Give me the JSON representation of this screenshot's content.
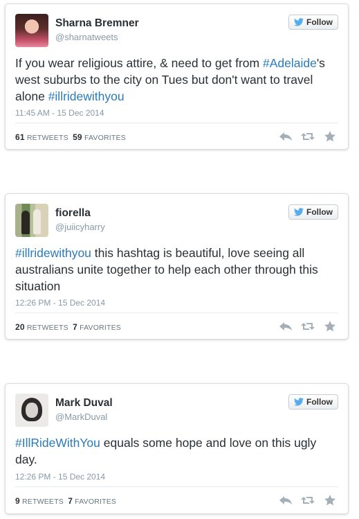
{
  "colors": {
    "hashtag": "#2b7bb9",
    "name": "#292f33",
    "muted": "#8899a6",
    "bird": "#55acee"
  },
  "follow_label": "Follow",
  "icons": [
    "twitter-bird-icon",
    "reply-icon",
    "retweet-icon",
    "favorite-star-icon"
  ],
  "tweets": [
    {
      "name": "Sharna Bremner",
      "handle": "@sharnatweets",
      "text_parts": [
        {
          "t": "If you wear religious attire, & need to get from ",
          "tag": false
        },
        {
          "t": "#Adelaide",
          "tag": true
        },
        {
          "t": "'s west suburbs to the city on Tues but don't want to travel alone ",
          "tag": false
        },
        {
          "t": "#illridewithyou",
          "tag": true
        }
      ],
      "time": "11:45 AM - 15 Dec 2014",
      "retweets": "61",
      "retweets_label": "RETWEETS",
      "favorites": "59",
      "favorites_label": "FAVORITES"
    },
    {
      "name": "fiorella",
      "handle": "@juiicyharry",
      "text_parts": [
        {
          "t": "#illridewithyou",
          "tag": true
        },
        {
          "t": " this hashtag is beautiful, love seeing all australians unite together to help each other through this situation",
          "tag": false
        }
      ],
      "time": "12:26 PM - 15 Dec 2014",
      "retweets": "20",
      "retweets_label": "RETWEETS",
      "favorites": "7",
      "favorites_label": "FAVORITES"
    },
    {
      "name": "Mark Duval",
      "handle": "@MarkDuval",
      "text_parts": [
        {
          "t": "#IllRideWithYou",
          "tag": true
        },
        {
          "t": " equals some hope and love on this ugly day.",
          "tag": false
        }
      ],
      "time": "12:26 PM - 15 Dec 2014",
      "retweets": "9",
      "retweets_label": "RETWEETS",
      "favorites": "7",
      "favorites_label": "FAVORITES"
    }
  ]
}
